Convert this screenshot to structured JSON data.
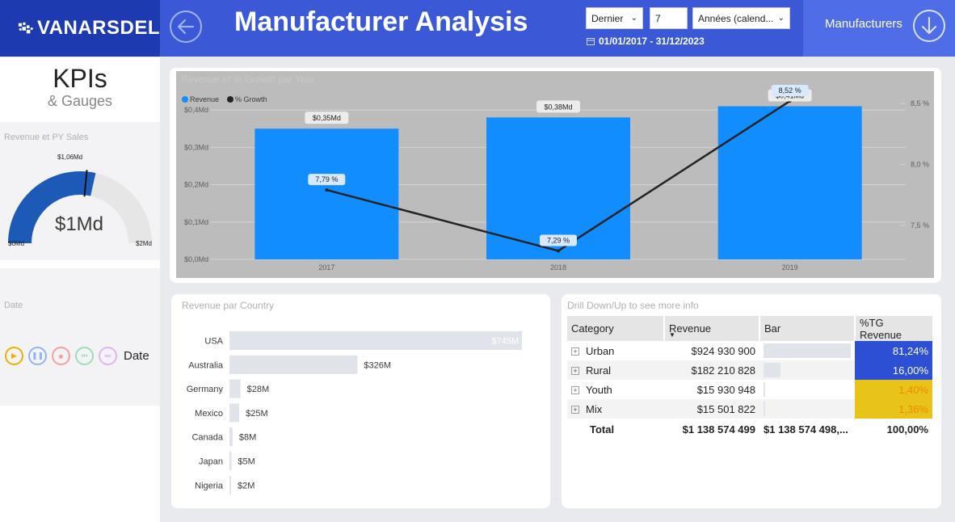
{
  "header": {
    "logo_text": "VANARSDEL",
    "title": "Manufacturer Analysis",
    "slicer_period": "Dernier",
    "slicer_count": "7",
    "slicer_unit": "Années (calend...",
    "date_range": "01/01/2017 - 31/12/2023",
    "nav_label": "Manufacturers",
    "colors": {
      "header_bg": "#3b59d6",
      "logo_bg": "#1d3ab0",
      "nav_bg": "#4f6de6"
    }
  },
  "left": {
    "kpi_title": "KPIs",
    "kpi_sub": "& Gauges",
    "gauge": {
      "title": "Revenue et PY Sales",
      "value_label": "$1Md",
      "target_label": "$1,06Md",
      "min_label": "$0Md",
      "max_label": "$2Md",
      "value": 1.14,
      "target": 1.06,
      "min": 0,
      "max": 2
    },
    "date_player": {
      "title": "Date",
      "label": "Date",
      "buttons": [
        {
          "icon": "play-icon",
          "color": "#e8b400"
        },
        {
          "icon": "pause-icon",
          "color": "#6d9de8"
        },
        {
          "icon": "stop-icon",
          "color": "#f08080"
        },
        {
          "icon": "rewind-icon",
          "color": "#7fcfa0"
        },
        {
          "icon": "fast-forward-icon",
          "color": "#d79cf0"
        }
      ]
    }
  },
  "revenue_chart": {
    "title": "Revenue et % Growth par Year",
    "legend": [
      "Revenue",
      "% Growth"
    ]
  },
  "country_chart": {
    "title": "Revenue par Country"
  },
  "drill": {
    "title": "Drill Down/Up to see more info",
    "headers": [
      "Category",
      "Revenue",
      "Bar",
      "%TG Revenue"
    ],
    "rows": [
      {
        "category": "Urban",
        "revenue": "$924 930 900",
        "bar": 0.8124,
        "pct": "81,24%",
        "pct_bg": "#2d4fd4",
        "pct_fg": "#ffffff"
      },
      {
        "category": "Rural",
        "revenue": "$182 210 828",
        "bar": 0.16,
        "pct": "16,00%",
        "pct_bg": "#2d4fd4",
        "pct_fg": "#ffffff"
      },
      {
        "category": "Youth",
        "revenue": "$15 930 948",
        "bar": 0.014,
        "pct": "1,40%",
        "pct_bg": "#e8c31a",
        "pct_fg": "#f08a00"
      },
      {
        "category": "Mix",
        "revenue": "$15 501 822",
        "bar": 0.0136,
        "pct": "1,36%",
        "pct_bg": "#e8c31a",
        "pct_fg": "#f08a00"
      }
    ],
    "total": {
      "label": "Total",
      "revenue": "$1 138 574 499",
      "bar": "$1 138 574 498,...",
      "pct": "100,00%"
    }
  },
  "chart_data": [
    {
      "type": "bar",
      "title": "Revenue et % Growth par Year",
      "categories": [
        "2017",
        "2018",
        "2019"
      ],
      "series": [
        {
          "name": "Revenue",
          "values": [
            0.35,
            0.38,
            0.41
          ],
          "labels": [
            "$0,35Md",
            "$0,38Md",
            "$0,41Md"
          ],
          "color": "#118dff"
        },
        {
          "name": "% Growth",
          "type": "line",
          "values": [
            7.79,
            7.29,
            8.52
          ],
          "labels": [
            "7,79 %",
            "7,29 %",
            "8,52 %"
          ],
          "color": "#252423"
        }
      ],
      "y_ticks": [
        "$0,0Md",
        "$0,1Md",
        "$0,2Md",
        "$0,3Md",
        "$0,4Md"
      ],
      "ylim": [
        0,
        0.45
      ],
      "y2_ticks": [
        "7,5 %",
        "8,0 %",
        "8,5 %"
      ],
      "y2lim": [
        7.22,
        8.6
      ],
      "legend_position": "top-left",
      "grid": true
    },
    {
      "type": "bar",
      "orientation": "horizontal",
      "title": "Revenue par Country",
      "categories": [
        "USA",
        "Australia",
        "Germany",
        "Mexico",
        "Canada",
        "Japan",
        "Nigeria"
      ],
      "values": [
        745,
        326,
        28,
        25,
        8,
        5,
        2
      ],
      "labels": [
        "$745M",
        "$326M",
        "$28M",
        "$25M",
        "$8M",
        "$5M",
        "$2M"
      ],
      "xlim": [
        0,
        745
      ],
      "color": "#e1e3ea"
    }
  ]
}
